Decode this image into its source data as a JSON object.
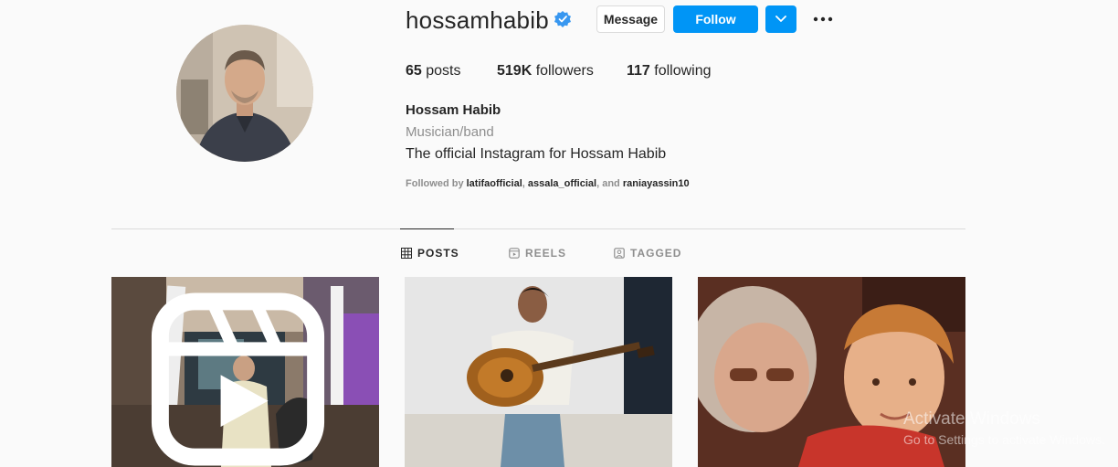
{
  "profile": {
    "username": "hossamhabib",
    "verified": true,
    "message_label": "Message",
    "follow_label": "Follow",
    "stats": {
      "posts_count": "65",
      "posts_label": "posts",
      "followers_count": "519K",
      "followers_label": "followers",
      "following_count": "117",
      "following_label": "following"
    },
    "full_name": "Hossam Habib",
    "category": "Musician/band",
    "bio": "The official Instagram for Hossam Habib",
    "followed_by_prefix": "Followed by",
    "followed_by": [
      "latifaofficial",
      "assala_official",
      "raniayassin10"
    ],
    "followed_by_and": "and"
  },
  "tabs": [
    {
      "label": "POSTS",
      "icon": "grid-icon",
      "active": true
    },
    {
      "label": "REELS",
      "icon": "reels-icon",
      "active": false
    },
    {
      "label": "TAGGED",
      "icon": "tagged-icon",
      "active": false
    }
  ],
  "posts": [
    {
      "type": "reel"
    },
    {
      "type": "photo"
    },
    {
      "type": "photo"
    }
  ],
  "watermark": {
    "line1": "Activate Windows",
    "line2": "Go to Settings to activate Windows."
  },
  "colors": {
    "accent": "#0095f6",
    "verified": "#3897f0",
    "text": "#262626",
    "muted": "#8e8e8e"
  }
}
